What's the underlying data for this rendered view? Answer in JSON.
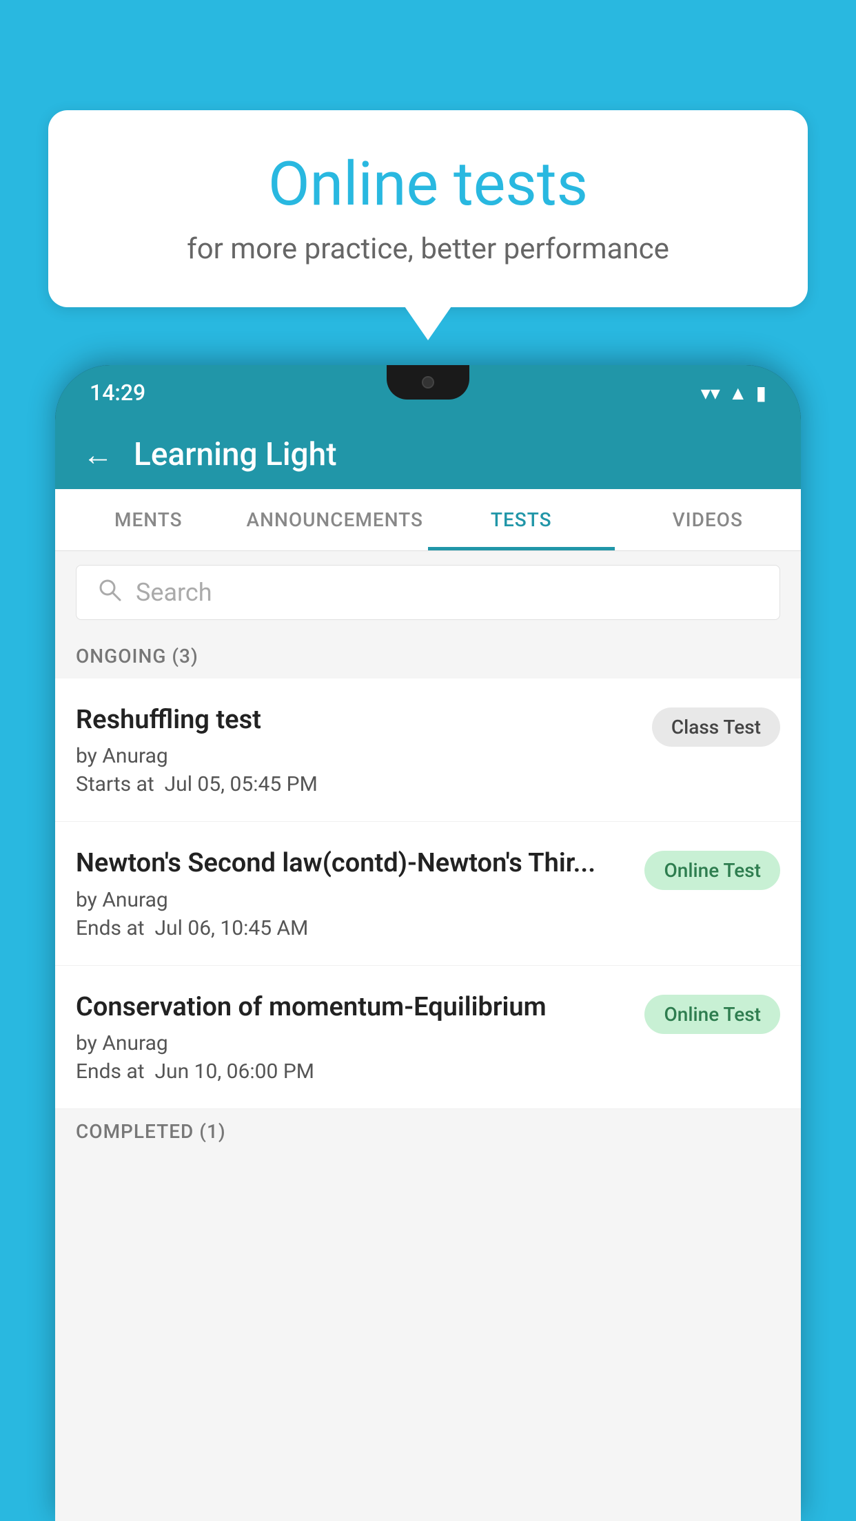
{
  "background_color": "#29b8e0",
  "promo": {
    "title": "Online tests",
    "subtitle": "for more practice, better performance"
  },
  "phone": {
    "status_time": "14:29",
    "app_title": "Learning Light",
    "tabs": [
      {
        "id": "ments",
        "label": "MENTS",
        "active": false
      },
      {
        "id": "announcements",
        "label": "ANNOUNCEMENTS",
        "active": false
      },
      {
        "id": "tests",
        "label": "TESTS",
        "active": true
      },
      {
        "id": "videos",
        "label": "VIDEOS",
        "active": false
      }
    ],
    "search_placeholder": "Search",
    "section_ongoing": "ONGOING (3)",
    "section_completed": "COMPLETED (1)",
    "tests": [
      {
        "name": "Reshuffling test",
        "author": "by Anurag",
        "date_label": "Starts at",
        "date": "Jul 05, 05:45 PM",
        "badge": "Class Test",
        "badge_type": "class"
      },
      {
        "name": "Newton's Second law(contd)-Newton's Thir...",
        "author": "by Anurag",
        "date_label": "Ends at",
        "date": "Jul 06, 10:45 AM",
        "badge": "Online Test",
        "badge_type": "online"
      },
      {
        "name": "Conservation of momentum-Equilibrium",
        "author": "by Anurag",
        "date_label": "Ends at",
        "date": "Jun 10, 06:00 PM",
        "badge": "Online Test",
        "badge_type": "online"
      }
    ]
  }
}
